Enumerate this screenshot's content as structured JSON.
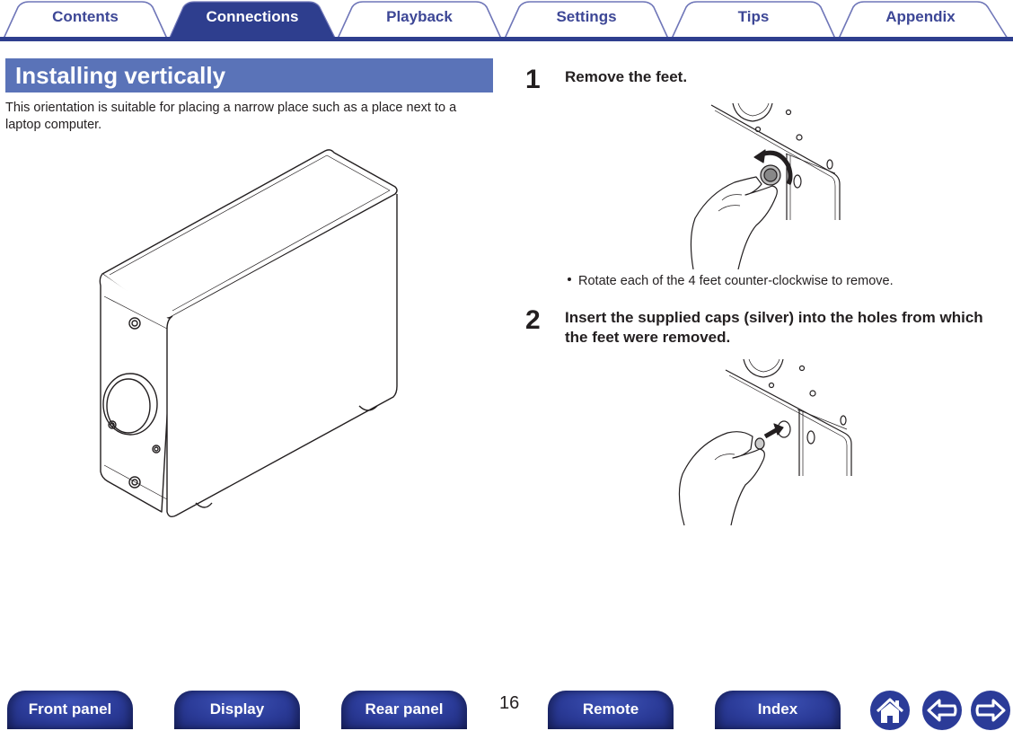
{
  "tabs": [
    {
      "label": "Contents",
      "active": false
    },
    {
      "label": "Connections",
      "active": true
    },
    {
      "label": "Playback",
      "active": false
    },
    {
      "label": "Settings",
      "active": false
    },
    {
      "label": "Tips",
      "active": false
    },
    {
      "label": "Appendix",
      "active": false
    }
  ],
  "colors": {
    "tab_active": "#2e3e8e",
    "tab_outline": "#6f76b8",
    "tab_text": "#3d4796",
    "section_title_bg": "#5a73b8",
    "nav_button": "#2b3b98"
  },
  "section": {
    "title": "Installing vertically",
    "intro": "This orientation is suitable for placing a narrow place such as a place next to a laptop computer."
  },
  "steps": [
    {
      "number": "1",
      "text": "Remove the feet.",
      "bullets": [
        "Rotate each of the 4 feet counter-clockwise to remove."
      ]
    },
    {
      "number": "2",
      "text": "Insert the supplied caps (silver) into the holes from which the feet were removed.",
      "bullets": []
    }
  ],
  "bottom_nav": {
    "buttons": [
      "Front panel",
      "Display",
      "Rear panel",
      "Remote",
      "Index"
    ],
    "page_number": "16",
    "icons": [
      "home-icon",
      "back-arrow-icon",
      "forward-arrow-icon"
    ]
  }
}
